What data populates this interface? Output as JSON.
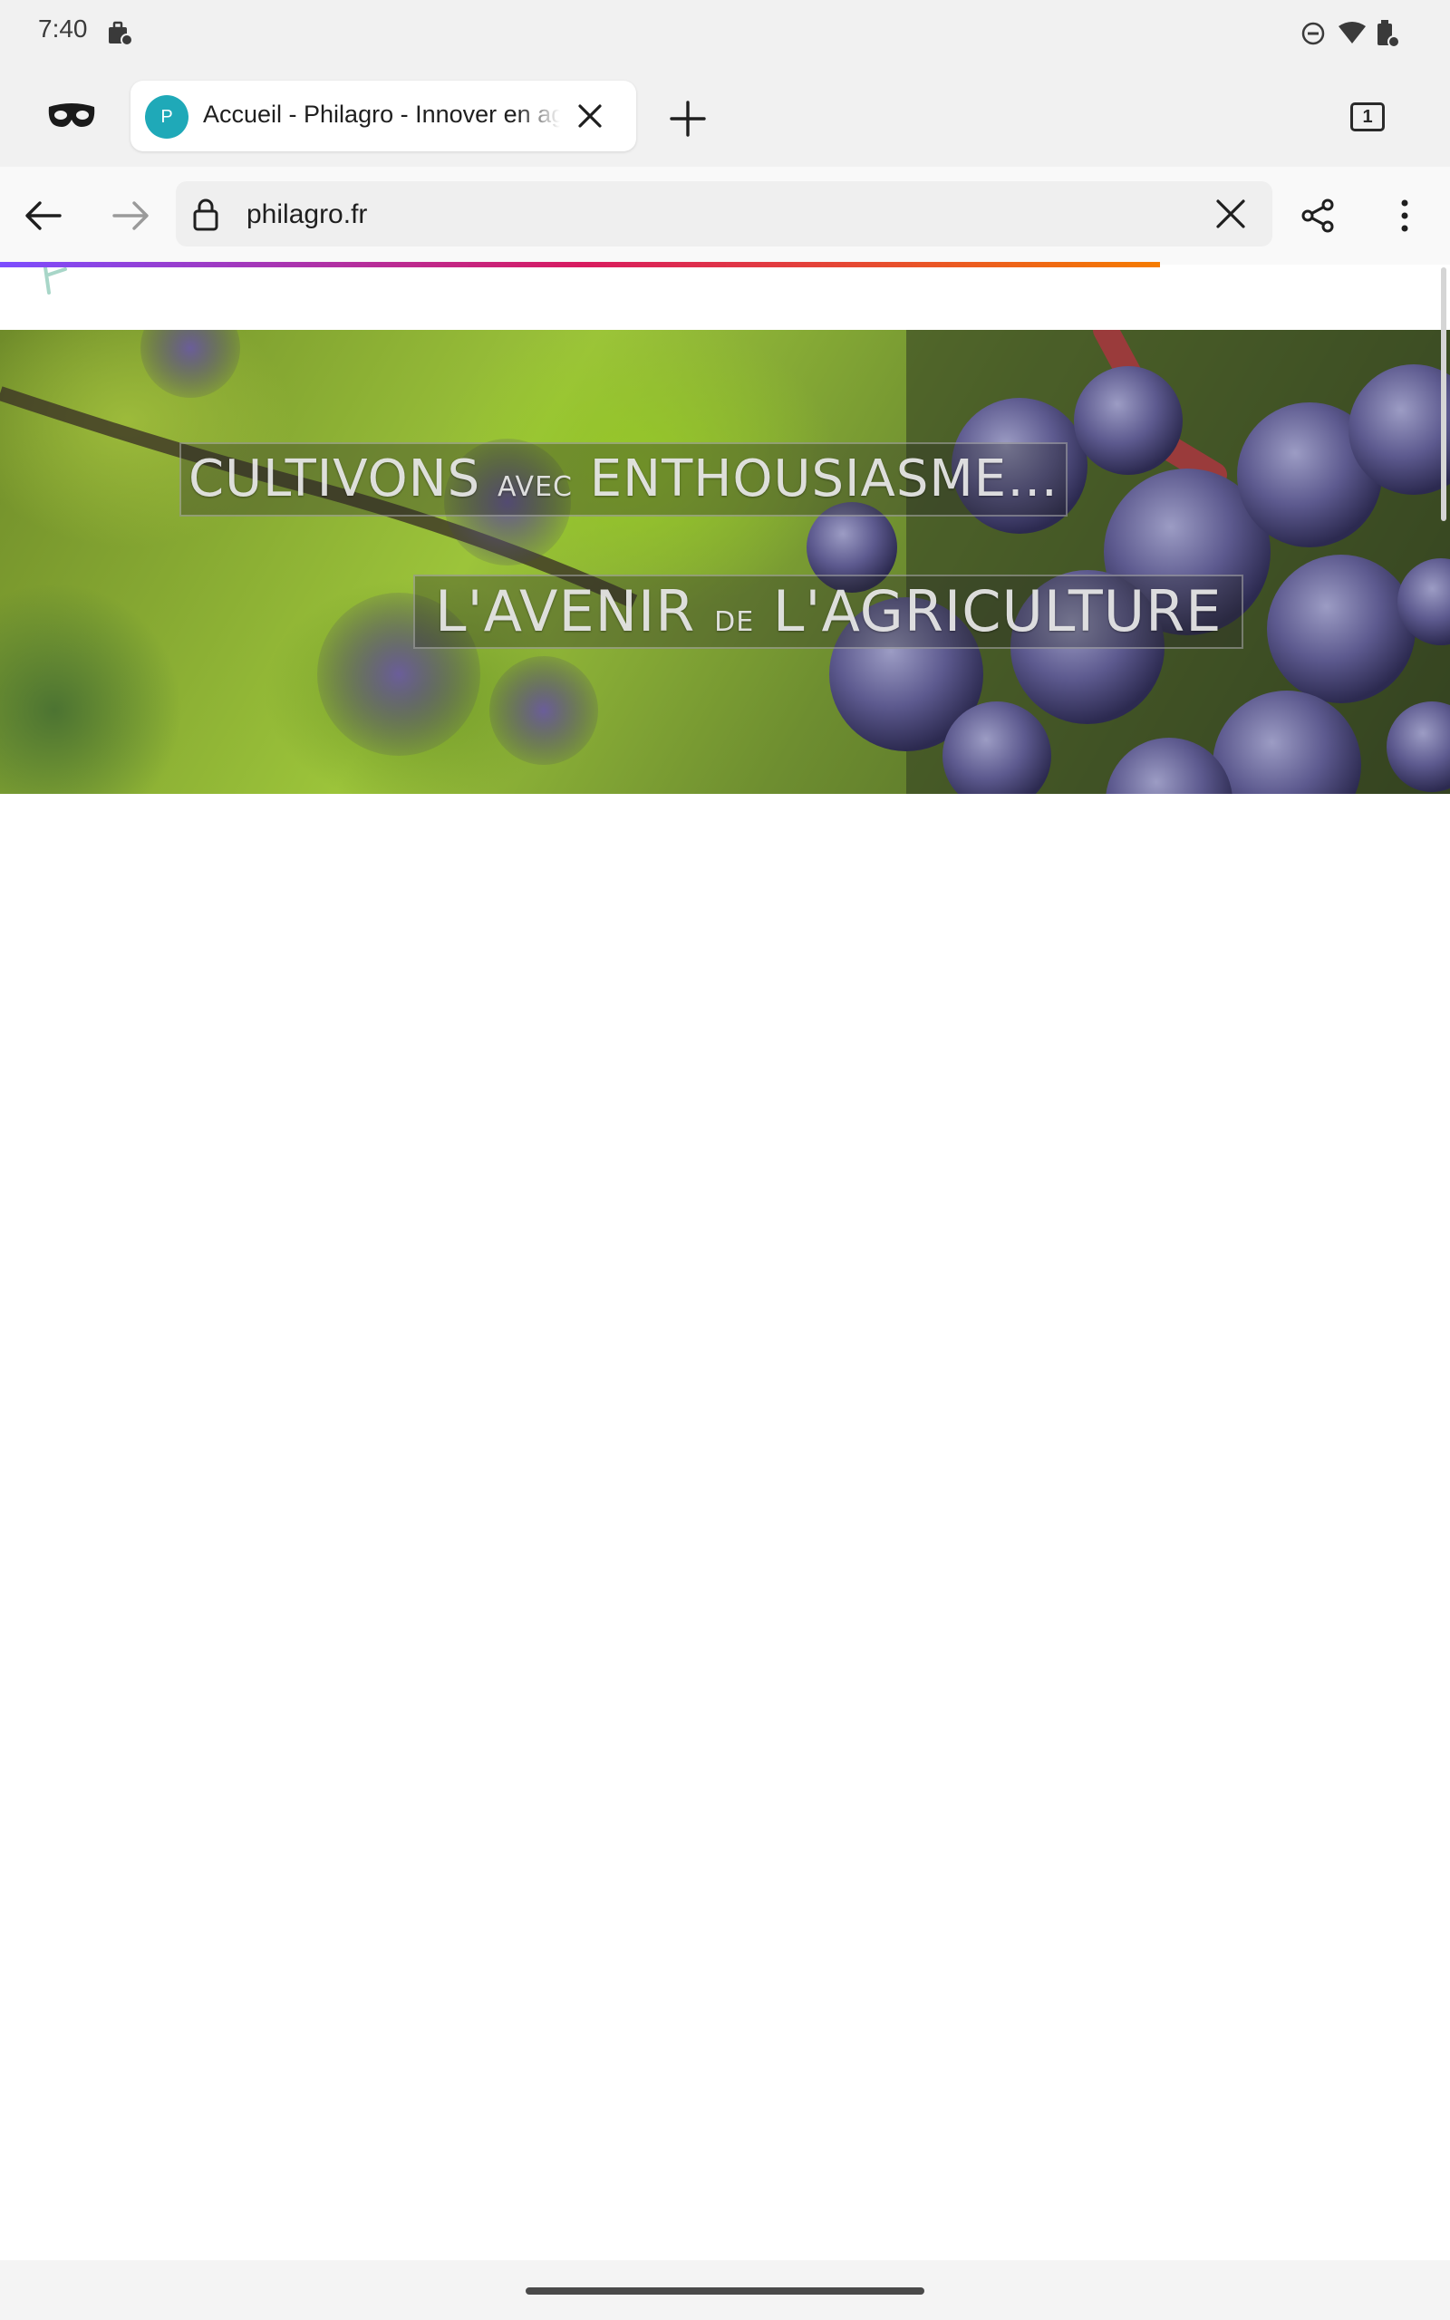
{
  "status_bar": {
    "time": "7:40",
    "icons": [
      "work-profile-icon",
      "do-not-disturb-icon",
      "wifi-icon",
      "battery-icon"
    ]
  },
  "tabs": {
    "private_icon": "private-browsing-mask-icon",
    "active": {
      "favicon_letter": "P",
      "favicon_color": "#1fa9b8",
      "title": "Accueil - Philagro - Innover en agriculture"
    },
    "new_tab_icon": "plus-icon",
    "tab_count": "1"
  },
  "toolbar": {
    "back_icon": "arrow-left-icon",
    "forward_icon": "arrow-right-icon",
    "url": "philagro.fr",
    "clear_icon": "close-icon",
    "share_icon": "share-icon",
    "menu_icon": "more-vertical-icon"
  },
  "progress": {
    "fraction": 0.8
  },
  "hero": {
    "line1_a": "CULTIVONS",
    "line1_b": "AVEC",
    "line1_c": "ENTHOUSIASME…",
    "line2_a": "L'AVENIR",
    "line2_b": "DE",
    "line2_c": "L'AGRICULTURE"
  },
  "colors": {
    "progress_start": "#7c4dff",
    "progress_mid": "#d81b60",
    "progress_end": "#f57c00",
    "favicon": "#1fa9b8",
    "grape": "#5d5a8f"
  }
}
